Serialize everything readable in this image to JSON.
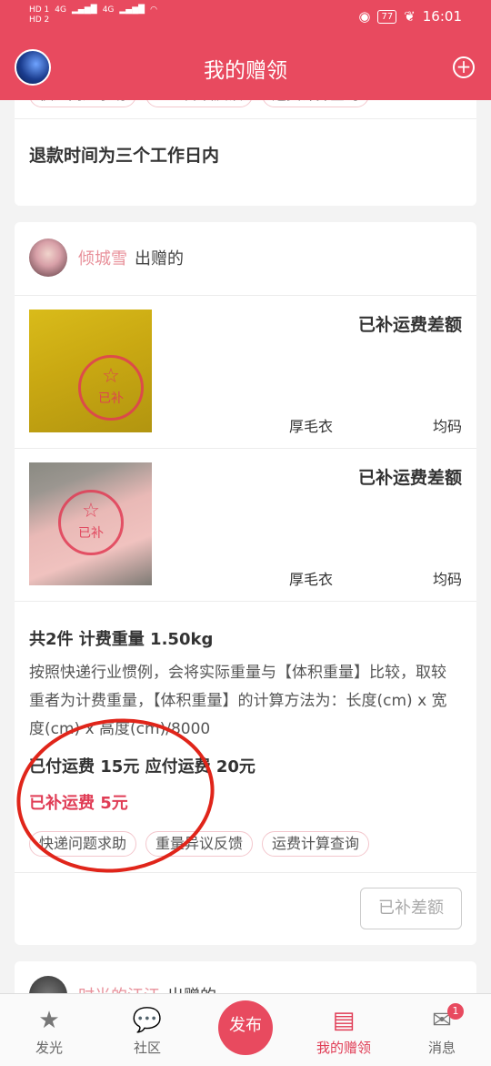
{
  "status_bar": {
    "sim1": "HD 1",
    "sim2": "HD 2",
    "net1": "4G",
    "net2": "4G",
    "battery": "77",
    "time": "16:01"
  },
  "header": {
    "title": "我的赠领"
  },
  "tags": [
    "快递问题求助",
    "重量异议反馈",
    "运费计算查询"
  ],
  "card1": {
    "refund_text": "退款时间为三个工作日内"
  },
  "card2": {
    "giver_name": "倾城雪",
    "giver_suffix": "出赠的",
    "items": [
      {
        "status": "已补运费差额",
        "name": "厚毛衣",
        "size": "均码",
        "stamp": "已补"
      },
      {
        "status": "已补运费差额",
        "name": "厚毛衣",
        "size": "均码",
        "stamp": "已补"
      }
    ],
    "summary": "共2件 计费重量 1.50kg",
    "note": "按照快递行业惯例，会将实际重量与【体积重量】比较，取较重者为计费重量，【体积重量】的计算方法为：长度(cm) x 宽度(cm) x 高度(cm)/8000",
    "paid": "已付运费 15元   应付运费 20元",
    "extra": "已补运费 5元",
    "action": "已补差额"
  },
  "card3": {
    "giver_name": "时光的江江",
    "giver_suffix": "出赠的"
  },
  "bottom_nav": {
    "items": [
      {
        "label": "发光",
        "icon": "star-icon"
      },
      {
        "label": "社区",
        "icon": "chat-icon"
      },
      {
        "label": "发布",
        "icon": "publish-icon"
      },
      {
        "label": "我的赠领",
        "icon": "gift-icon"
      },
      {
        "label": "消息",
        "icon": "mail-icon"
      }
    ],
    "message_badge": "1"
  }
}
